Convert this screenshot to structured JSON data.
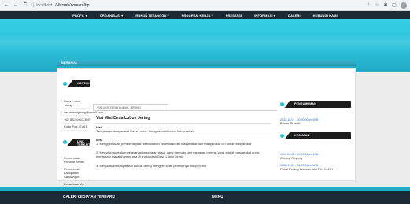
{
  "browser": {
    "url_info": "ⓘ localhost",
    "url": "/Marsah/nomaru/hp",
    "back": "←",
    "forward": "→",
    "reload": "C"
  },
  "site_nav": {
    "items": [
      {
        "label": "PROFIL ▾"
      },
      {
        "label": "ORGANISASI ▾"
      },
      {
        "label": "RUKUN TETANGGA ▾"
      },
      {
        "label": "PROGRAM KERJA ▾"
      },
      {
        "label": "PRESTASI"
      },
      {
        "label": "INFORMASI ▾"
      },
      {
        "label": "GALERI"
      },
      {
        "label": "HUBUNGI KAMI"
      }
    ]
  },
  "breadcrumb": {
    "label": "BERANDA"
  },
  "left_sidebar": {
    "kontak": {
      "title": "KONTAK",
      "items": [
        "Desa Lubuk Jering",
        "desalubukjering@gmail.com",
        "+62 852-1963-365",
        "Kode Pos 37461"
      ]
    },
    "link_terkait": {
      "title": "LINK TERKAIT",
      "items": [
        "Pemerintah Provinsi Jambi",
        "Pemerintah Kabupaten Sarolangun",
        "Kecamatan Air Hitam"
      ]
    }
  },
  "main": {
    "tab": "VISI MISI DESA LUBUK JERING",
    "title": "Visi Misi Desa Lubuk Jering",
    "visi_heading": "Visi",
    "visi_text": "Terciptanya masyarakat Desa Lubuk Jering mandiri untuk hidup sehat",
    "misi_heading": "Misi",
    "misi_items": [
      "1. Menggerakkan pemberdayaan kemudahan kesehatan diri masyarakat dan masyarakat diri untuk masyarakat",
      "2. Menyelenggarakan pelayanan kesehatan dasar yang bermutu dan menggali potensi yang ada di masyarakat guna mengatasi masalah yang ada di lingkungan Desa Lubuk Jering",
      "3. Menjadikan masyarakat Lubuk Jering mengerti akan pentingnya hidup Sehat"
    ]
  },
  "right_sidebar": {
    "pengumuman": {
      "title": "PENGUMUMAN",
      "items": [
        {
          "date": "2022-10-01 - 00:00:00pm WIB",
          "name": "Bersih Rumah"
        }
      ]
    },
    "kegiatan": {
      "title": "KEGIATAN",
      "items": [
        {
          "date": "2019-04-25 - 09:23:00pm WIB",
          "name": "Gotong Royong"
        },
        {
          "date": "2022-05-04 - 11:43:00am WIB",
          "name": "Pukul Pinang Lebaran Idul Fitri 1443 H"
        }
      ]
    }
  },
  "footer": {
    "left_heading": "GALERI KEGIATAN TERBARU",
    "right_heading": "MENU"
  },
  "colors": {
    "accent": "#2bbfd8",
    "nav": "#1c2a36",
    "widget": "#1b1b1b",
    "link": "#2a6bd1"
  }
}
